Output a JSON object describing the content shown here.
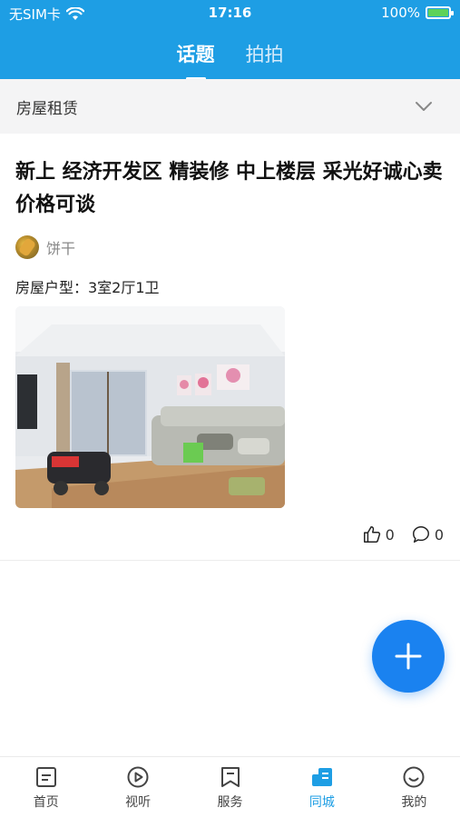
{
  "status_bar": {
    "carrier": "无SIM卡",
    "time": "17:16",
    "battery": "100%",
    "battery_level": 1.0
  },
  "header": {
    "tabs": [
      {
        "label": "话题",
        "active": true
      },
      {
        "label": "拍拍",
        "active": false
      }
    ]
  },
  "category": {
    "label": "房屋租赁"
  },
  "post": {
    "title": "新上 经济开发区 精装修 中上楼层 采光好诚心卖价格可谈",
    "author": "饼干",
    "house_type": "房屋户型：3室2厅1卫",
    "likes": "0",
    "comments": "0"
  },
  "bottom_nav": {
    "items": [
      {
        "label": "首页",
        "icon": "home-icon",
        "active": false
      },
      {
        "label": "视听",
        "icon": "play-icon",
        "active": false
      },
      {
        "label": "服务",
        "icon": "bookmark-icon",
        "active": false
      },
      {
        "label": "同城",
        "icon": "city-icon",
        "active": true
      },
      {
        "label": "我的",
        "icon": "smile-icon",
        "active": false
      }
    ]
  },
  "colors": {
    "primary": "#1e9ee4",
    "fab": "#1a82f0",
    "battery_fill": "#5dd25a"
  }
}
